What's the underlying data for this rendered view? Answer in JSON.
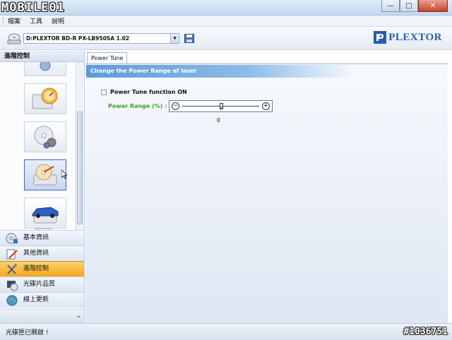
{
  "window": {
    "logo_text": "MOBILE01",
    "controls": {
      "minimize": "—",
      "maximize": "□",
      "close": "✕"
    }
  },
  "menu": {
    "items": [
      {
        "label": "檔案"
      },
      {
        "label": "工具"
      },
      {
        "label": "說明"
      }
    ]
  },
  "drivebar": {
    "drive_value": "D:PLEXTOR BD-R  PX-LB950SA 1.02",
    "brand": "PLEXTOR"
  },
  "sidebar": {
    "header": "進階控制",
    "nav_items": [
      {
        "label": "基本資訊",
        "icon": "cd-info-icon"
      },
      {
        "label": "其他資訊",
        "icon": "document-pencil-icon"
      },
      {
        "label": "進階控制",
        "icon": "tools-icon",
        "active": true
      },
      {
        "label": "光碟片品質",
        "icon": "film-disc-icon"
      },
      {
        "label": "線上更新",
        "icon": "globe-icon"
      }
    ]
  },
  "main": {
    "tab_label": "Power Tune",
    "banner_text": "Change the Power Range of laser",
    "checkbox_label": "Power Tune function ON",
    "range_label": "Power Range (%) :",
    "slider_value": "0",
    "slider_fraction": 0.5
  },
  "status": {
    "text": "光碟匣已關啟 !",
    "watermark": "#1036751"
  },
  "colors": {
    "accent_blue": "#5f9ad6",
    "active_nav": "#f3a623",
    "range_label_green": "#3ea02d",
    "brand_blue": "#2a5ca8"
  }
}
